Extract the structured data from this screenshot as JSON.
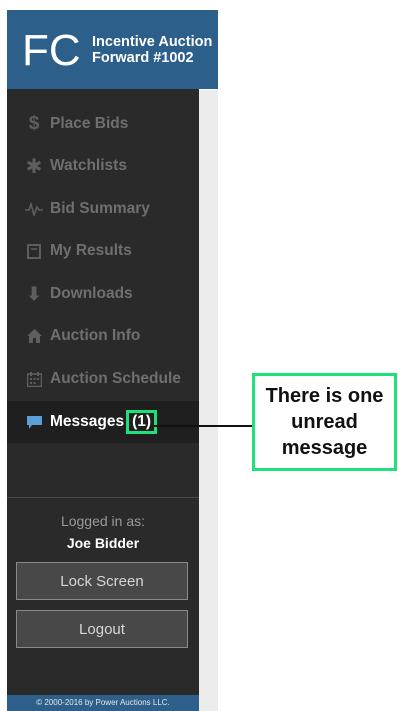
{
  "header": {
    "logo_text": "FC",
    "title_line1": "Incentive Auction",
    "title_line2": "Forward #1002"
  },
  "nav": [
    {
      "label": "Place Bids",
      "icon": "dollar-icon"
    },
    {
      "label": "Watchlists",
      "icon": "asterisk-icon"
    },
    {
      "label": "Bid Summary",
      "icon": "pulse-icon"
    },
    {
      "label": "My Results",
      "icon": "book-icon"
    },
    {
      "label": "Downloads",
      "icon": "download-arrow-icon"
    },
    {
      "label": "Auction Info",
      "icon": "home-icon"
    },
    {
      "label": "Auction Schedule",
      "icon": "calendar-icon"
    },
    {
      "label": "Messages",
      "icon": "chat-icon",
      "badge": "(1)",
      "active": true
    }
  ],
  "user": {
    "logged_in_label": "Logged in as:",
    "name": "Joe Bidder"
  },
  "buttons": {
    "lock": "Lock Screen",
    "logout": "Logout"
  },
  "footer": {
    "text": "© 2000-2016 by Power Auctions LLC."
  },
  "callout": {
    "text": "There is one unread message",
    "border_color": "#20e07a"
  },
  "colors": {
    "sidebar_bg": "#2a2a2a",
    "header_bg": "#2c5f8a",
    "active_icon": "#5aa0d8"
  }
}
